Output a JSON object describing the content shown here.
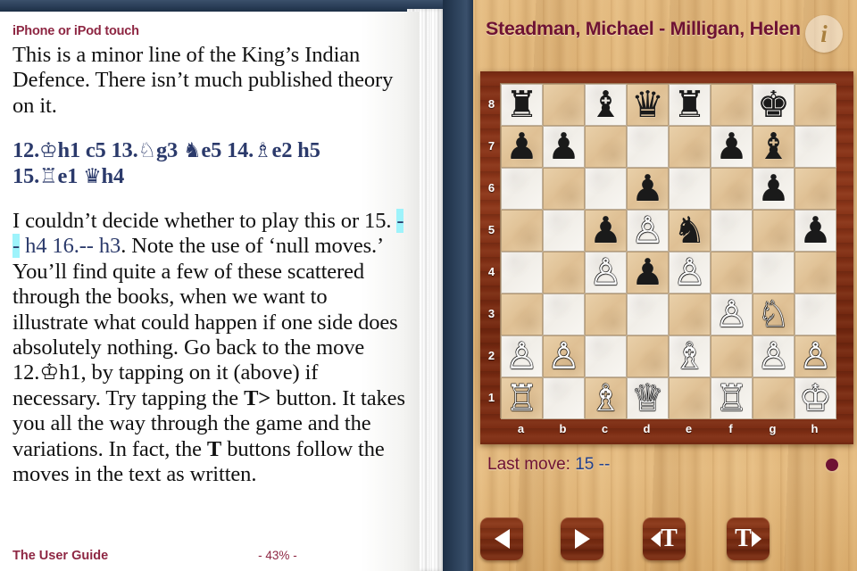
{
  "book": {
    "heading": "iPhone or iPod touch",
    "paragraph1": "This is a minor line of the King’s Indian Defence. There isn’t much published theory on it.",
    "moves_line": "12.♔h1 c5 13.♘g3 ♞e5 14.♗e2 h5 15.♖e1 ♛h4",
    "moves_tokens": [
      "12.",
      "♔",
      "h1 c5 13.",
      "♘",
      "g3 ",
      "♞",
      "e5 14.",
      "♗",
      "e2 h5",
      "15.",
      "♖",
      "e1 ",
      "♛",
      "h4"
    ],
    "para2_part1": "I couldn’t decide whether to play this or 15. ",
    "para2_highlight": "--",
    "para2_part2": " h4 16.-- h3",
    "para2_part3": ". Note the use of ‘null moves.’ You’ll find quite a few of these scattered through the books, when we want to illustrate what could happen if one side does absolutely nothing. Go back to the move 12.",
    "para2_king": "♔",
    "para2_part4": "h1, by tapping on it (above) if necessary. Try tapping the ",
    "para2_tbtn1": "T>",
    "para2_part5": " button. It takes you all the way through the game and the variations. In fact, the ",
    "para2_tbtn2": "T",
    "para2_part6": " buttons follow the moves in the text as written.",
    "footer_title": "The User Guide",
    "footer_percent": "- 43% -"
  },
  "header": {
    "game_title": "Steadman, Michael - Milligan, Helen",
    "info_icon": "info-icon",
    "info_glyph": "i"
  },
  "board": {
    "files": [
      "a",
      "b",
      "c",
      "d",
      "e",
      "f",
      "g",
      "h"
    ],
    "ranks": [
      "8",
      "7",
      "6",
      "5",
      "4",
      "3",
      "2",
      "1"
    ],
    "position_fen": "r1bqr1k1/pp3pb1/3p2p1/2pPn2p/2PpP3/5PN1/PP2B1PP/R1BQ1R1K",
    "rows": [
      [
        "♜",
        "",
        "♝",
        "♛",
        "♜",
        "",
        "♚",
        ""
      ],
      [
        "♟",
        "♟",
        "",
        "",
        "",
        "♟",
        "♝",
        ""
      ],
      [
        "",
        "",
        "",
        "♟",
        "",
        "",
        "♟",
        ""
      ],
      [
        "",
        "",
        "♟",
        "♙",
        "♞",
        "",
        "",
        "♟"
      ],
      [
        "",
        "",
        "♙",
        "♟",
        "♙",
        "",
        "",
        ""
      ],
      [
        "",
        "",
        "",
        "",
        "",
        "♙",
        "♘",
        ""
      ],
      [
        "♙",
        "♙",
        "",
        "",
        "♗",
        "",
        "♙",
        "♙"
      ],
      [
        "♖",
        "",
        "♗",
        "♕",
        "",
        "♖",
        "",
        "♔"
      ]
    ],
    "colors": [
      [
        "b",
        "",
        "b",
        "b",
        "b",
        "",
        "b",
        ""
      ],
      [
        "b",
        "b",
        "",
        "",
        "",
        "b",
        "b",
        ""
      ],
      [
        "",
        "",
        "",
        "b",
        "",
        "",
        "b",
        ""
      ],
      [
        "",
        "",
        "b",
        "w",
        "b",
        "",
        "",
        "b"
      ],
      [
        "",
        "",
        "w",
        "b",
        "w",
        "",
        "",
        ""
      ],
      [
        "",
        "",
        "",
        "",
        "",
        "w",
        "w",
        ""
      ],
      [
        "w",
        "w",
        "",
        "",
        "w",
        "",
        "w",
        "w"
      ],
      [
        "w",
        "",
        "w",
        "w",
        "",
        "w",
        "",
        "w"
      ]
    ]
  },
  "status": {
    "last_move_label": "Last move: ",
    "last_move_value": "15 --",
    "turn_indicator": "turn-dot"
  },
  "controls": {
    "buttons": [
      {
        "name": "move-back-button",
        "glyph": "◀"
      },
      {
        "name": "move-forward-button",
        "glyph": "▶"
      },
      {
        "name": "text-back-button",
        "glyph": "◀T"
      },
      {
        "name": "text-forward-button",
        "glyph": "T▶"
      }
    ]
  },
  "colors": {
    "heading_maroon": "#8e2743",
    "title_maroon": "#6e1233",
    "move_blue": "#2b3a6b",
    "highlight_cyan": "#9ef3fb",
    "wood": "#ddb174",
    "board_frame": "#7e2d15",
    "light_square": "#f6f3ee",
    "dark_square": "#e2c49a"
  }
}
